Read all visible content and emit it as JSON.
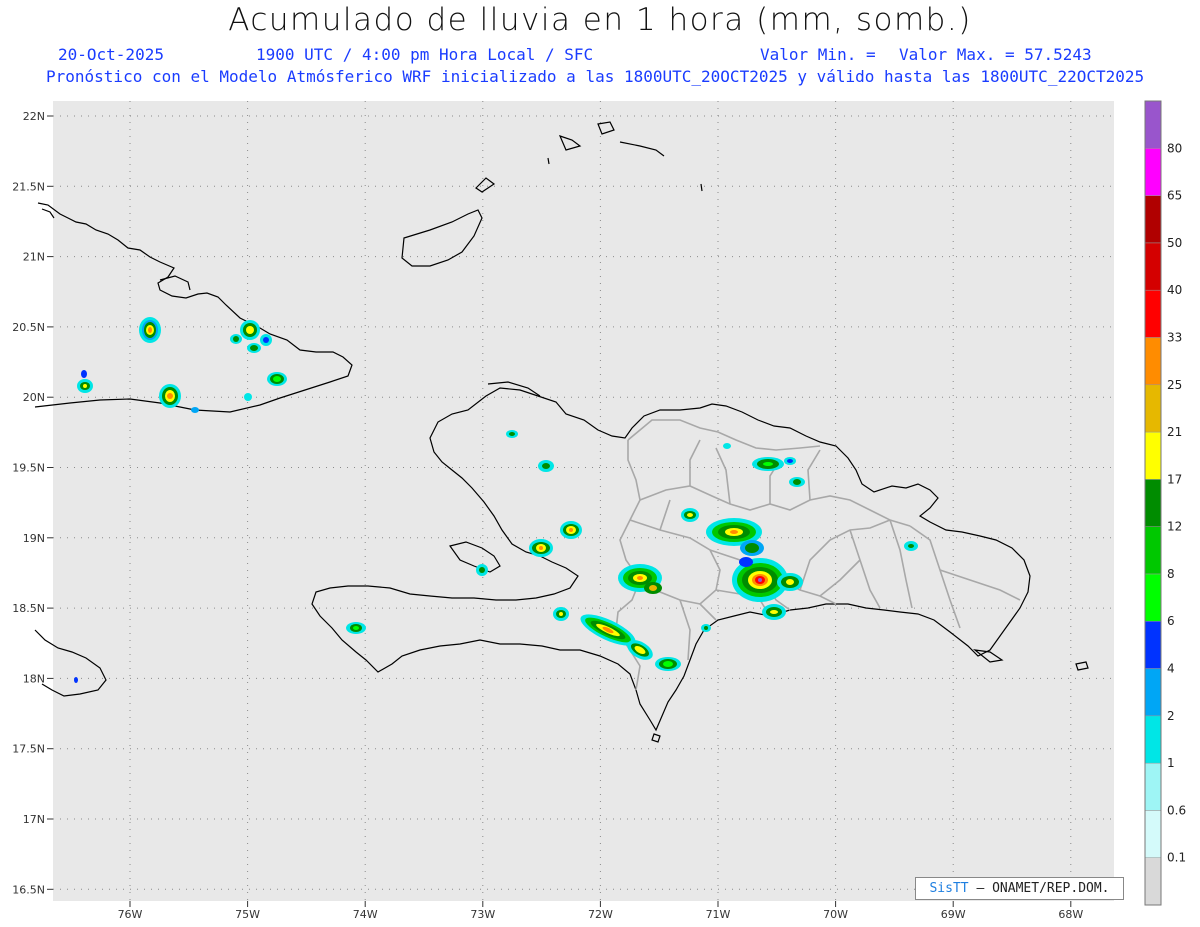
{
  "header": {
    "title": "Acumulado de lluvia en 1 hora (mm, somb.)",
    "date": "20-Oct-2025",
    "time_line": "1900 UTC / 4:00 pm Hora Local / SFC",
    "valor_min": "Valor Min. =",
    "valor_max": "Valor Max. = 57.5243",
    "forecast_line": "Pronóstico con el Modelo Atmósferico WRF inicializado a las 1800UTC_20OCT2025 y válido hasta las  1800UTC_22OCT2025"
  },
  "axes": {
    "lat_labels": [
      "22N",
      "21.5N",
      "21N",
      "20.5N",
      "20N",
      "19.5N",
      "19N",
      "18.5N",
      "18N",
      "17.5N",
      "17N",
      "16.5N"
    ],
    "lon_labels": [
      "76W",
      "75W",
      "74W",
      "73W",
      "72W",
      "71W",
      "70W",
      "69W",
      "68W"
    ]
  },
  "colorbar": {
    "labels": [
      "0.1",
      "0.6",
      "1",
      "2",
      "4",
      "6",
      "8",
      "12",
      "17",
      "21",
      "25",
      "33",
      "40",
      "50",
      "65",
      "80"
    ],
    "colors": [
      "#d9d9d9",
      "#d4fafa",
      "#9ef5f5",
      "#00e6e6",
      "#00a6f5",
      "#0033ff",
      "#00ff00",
      "#00c800",
      "#008c00",
      "#ffff00",
      "#e6b800",
      "#ff8c00",
      "#ff0000",
      "#d40000",
      "#b00000",
      "#ff00ff",
      "#9955cc"
    ]
  },
  "credit": {
    "logo": "SisTT",
    "text": "– ONAMET/REP.DOM."
  },
  "map_colors": {
    "background": "#e8e8e8",
    "coast": "#000000",
    "provinces": "#a8a8a8",
    "grid": "#888888"
  }
}
